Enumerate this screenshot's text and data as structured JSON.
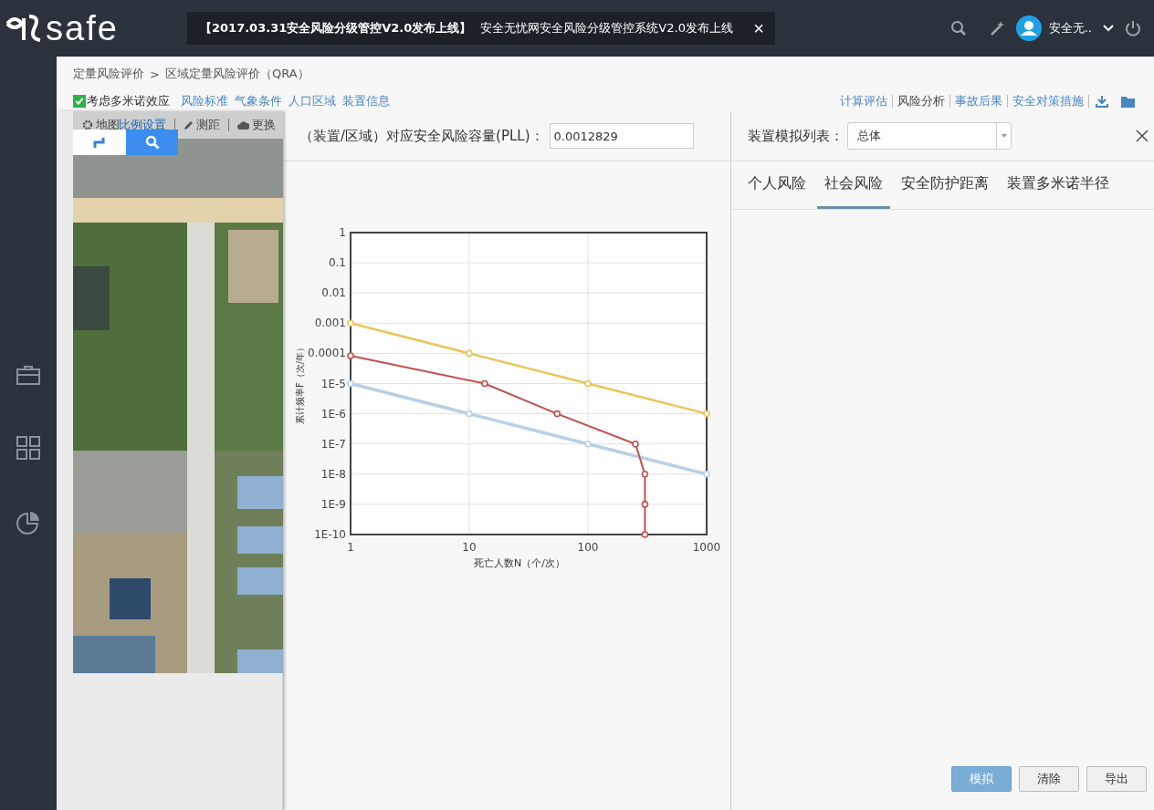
{
  "header": {
    "logo_text": "safe",
    "notice": {
      "bold": "【2017.03.31安全风险分级管控V2.0发布上线】",
      "text": "安全无忧网安全风险分级管控系统V2.0发布上线",
      "close": "×"
    },
    "user": "安全无.."
  },
  "breadcrumb": [
    {
      "label": "定量风险评价"
    },
    {
      "label": "区域定量风险评价（QRA）"
    }
  ],
  "breadcrumb_separator": ">",
  "toolbar": {
    "domino": {
      "label": "考虑多米诺效应",
      "checked": true
    },
    "links": [
      "风险标准",
      "气象条件",
      "人口区域",
      "装置信息"
    ],
    "actions": [
      {
        "label": "计算评估",
        "selected": false
      },
      {
        "label": "风险分析",
        "selected": true
      },
      {
        "label": "事故后果",
        "selected": false
      },
      {
        "label": "安全对策措施",
        "selected": false
      }
    ]
  },
  "map": {
    "tools": [
      {
        "label": "地图",
        "kind": "gear"
      },
      {
        "label": "比例设置",
        "kind": "plain"
      },
      {
        "label": "测距",
        "kind": "pen"
      },
      {
        "label": "更换",
        "kind": "cloud"
      }
    ]
  },
  "pll": {
    "label": "（装置/区域）对应安全风险容量(PLL)：",
    "value": "0.0012829"
  },
  "chart": {
    "xlabel": "死亡人数N（个/次）",
    "ylabel": "累计频率F（次/年）",
    "x_tick_labels": [
      "1",
      "10",
      "100",
      "1000"
    ],
    "y_tick_labels": [
      "1",
      "0.1",
      "0.01",
      "0.001",
      "0.0001",
      "1E-5",
      "1E-6",
      "1E-7",
      "1E-8",
      "1E-9",
      "1E-10"
    ]
  },
  "device_list": {
    "label": "装置模拟列表：",
    "value": "总体"
  },
  "tabs": [
    {
      "label": "个人风险",
      "selected": false
    },
    {
      "label": "社会风险",
      "selected": true
    },
    {
      "label": "安全防护距离",
      "selected": false
    },
    {
      "label": "装置多米诺半径",
      "selected": false
    }
  ],
  "buttons": [
    {
      "label": "模拟",
      "primary": true
    },
    {
      "label": "清除",
      "primary": false
    },
    {
      "label": "导出",
      "primary": false
    }
  ]
}
